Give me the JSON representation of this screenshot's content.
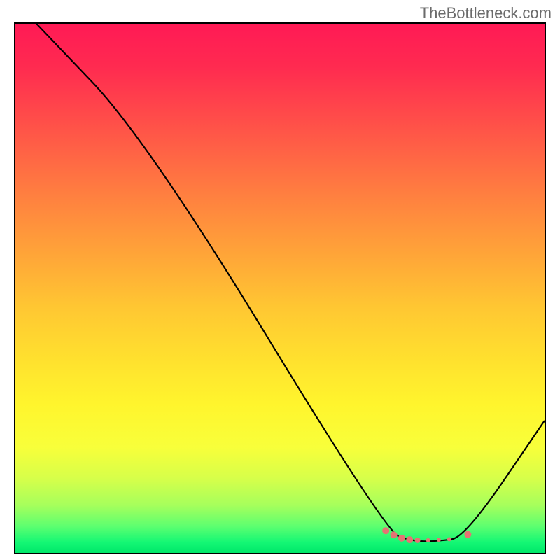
{
  "watermark": "TheBottleneck.com",
  "chart_data": {
    "type": "line",
    "title": "",
    "xlabel": "",
    "ylabel": "",
    "xlim": [
      0,
      100
    ],
    "ylim": [
      0,
      100
    ],
    "series": [
      {
        "name": "curve",
        "points": [
          [
            4,
            100
          ],
          [
            25,
            78
          ],
          [
            70,
            4
          ],
          [
            75,
            2.2
          ],
          [
            80,
            2.2
          ],
          [
            85,
            3
          ],
          [
            100,
            25
          ]
        ],
        "color": "#000000"
      }
    ],
    "markers": [
      {
        "x": 70,
        "y": 4.2,
        "color": "#e57373",
        "r": 5
      },
      {
        "x": 71.5,
        "y": 3.4,
        "color": "#e57373",
        "r": 5
      },
      {
        "x": 73,
        "y": 2.8,
        "color": "#e57373",
        "r": 5
      },
      {
        "x": 74.5,
        "y": 2.5,
        "color": "#e57373",
        "r": 5
      },
      {
        "x": 76,
        "y": 2.4,
        "color": "#e57373",
        "r": 4
      },
      {
        "x": 78,
        "y": 2.4,
        "color": "#e57373",
        "r": 3
      },
      {
        "x": 80,
        "y": 2.5,
        "color": "#e57373",
        "r": 3
      },
      {
        "x": 82,
        "y": 2.6,
        "color": "#e57373",
        "r": 3
      },
      {
        "x": 85.5,
        "y": 3.5,
        "color": "#e57373",
        "r": 5
      }
    ],
    "gradient_stops": [
      {
        "pct": 0,
        "color": "#ff1a55"
      },
      {
        "pct": 20,
        "color": "#ff5448"
      },
      {
        "pct": 44,
        "color": "#ffa638"
      },
      {
        "pct": 72,
        "color": "#fff52d"
      },
      {
        "pct": 91,
        "color": "#a6ff5c"
      },
      {
        "pct": 100,
        "color": "#00e86a"
      }
    ]
  }
}
